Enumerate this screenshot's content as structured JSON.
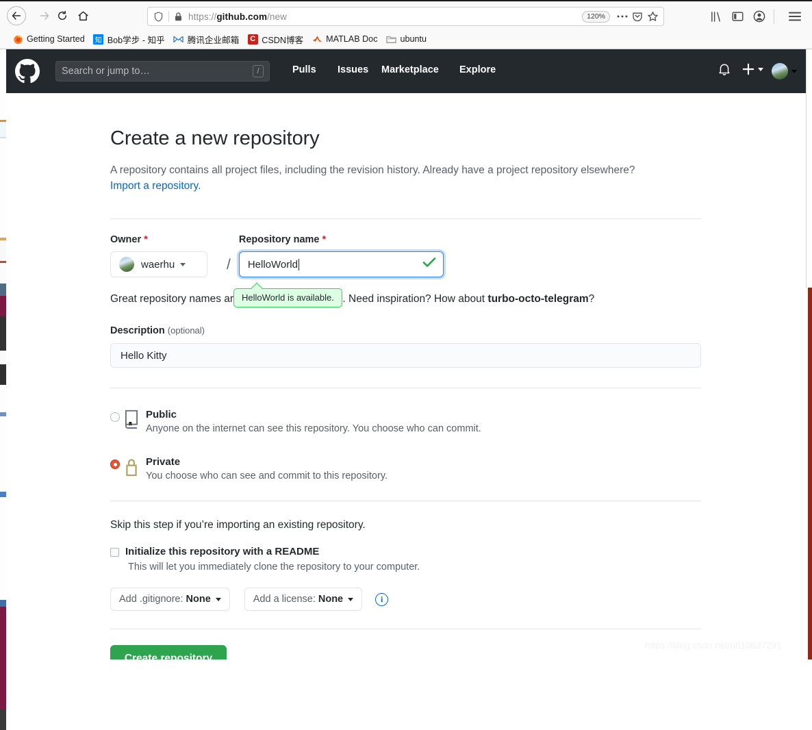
{
  "browser": {
    "nav": {
      "back": "back-arrow",
      "forward": "forward-arrow",
      "reload": "reload-arrow",
      "home": "home-icon"
    },
    "urlbar": {
      "url_prefix": "https://",
      "url_domain": "github.com",
      "url_path": "/new",
      "zoom_level": "120%",
      "shield_icon": "shield-icon",
      "lock_icon": "padlock-icon",
      "more_icon": "ellipsis-icon",
      "pocket_icon": "pocket-icon",
      "bookmark_icon": "star-icon"
    },
    "toolbar_right": {
      "library": "library-icon",
      "sidebar": "sidebar-icon",
      "account": "account-icon",
      "menu": "hamburger-menu-icon"
    },
    "bookmarks": [
      {
        "label": "Getting Started",
        "icon": "firefox-icon"
      },
      {
        "label": "Bob学步 - 知乎",
        "icon": "zhihu-icon"
      },
      {
        "label": "腾讯企业邮箱",
        "icon": "tencent-mail-icon"
      },
      {
        "label": "CSDN博客",
        "icon": "csdn-icon"
      },
      {
        "label": "MATLAB Doc",
        "icon": "matlab-icon"
      },
      {
        "label": "ubuntu",
        "icon": "folder-icon"
      }
    ]
  },
  "github_header": {
    "logo": "github-mark-icon",
    "search_placeholder": "Search or jump to…",
    "search_shortcut": "/",
    "nav": [
      {
        "label": "Pulls"
      },
      {
        "label": "Issues"
      },
      {
        "label": "Marketplace"
      },
      {
        "label": "Explore"
      }
    ],
    "notifications_icon": "bell-icon",
    "create_new_icon": "plus-icon",
    "avatar": "user-avatar"
  },
  "main": {
    "title": "Create a new repository",
    "subtitle": "A repository contains all project files, including the revision history. Already have a project repository elsewhere?",
    "import_link": "Import a repository.",
    "owner": {
      "label": "Owner",
      "required": "*",
      "value": "waerhu",
      "avatar": "owner-avatar"
    },
    "separator": "/",
    "repo_name": {
      "label": "Repository name",
      "required": "*",
      "value": "HelloWorld",
      "valid_icon": "check-icon"
    },
    "availability_tooltip": "HelloWorld is available.",
    "hint": {
      "prefix": "Great repository names are short and memorable. Need inspiration? How about ",
      "suggestion": "turbo-octo-telegram",
      "suffix": "?"
    },
    "description": {
      "label": "Description",
      "optional": "(optional)",
      "value": "Hello Kitty"
    },
    "visibility": [
      {
        "id": "public",
        "title": "Public",
        "desc": "Anyone on the internet can see this repository. You choose who can commit.",
        "icon": "repo-book-icon",
        "selected": false
      },
      {
        "id": "private",
        "title": "Private",
        "desc": "You choose who can see and commit to this repository.",
        "icon": "lock-icon",
        "selected": true
      }
    ],
    "skip_text": "Skip this step if you’re importing an existing repository.",
    "readme": {
      "title": "Initialize this repository with a README",
      "desc": "This will let you immediately clone the repository to your computer.",
      "checked": false
    },
    "gitignore_button": {
      "label": "Add .gitignore:",
      "value": "None"
    },
    "license_button": {
      "label": "Add a license:",
      "value": "None"
    },
    "info_icon": "info-icon",
    "create_button": "Create repository"
  },
  "watermark": "https://blog.csdn.net/u010637291",
  "colors": {
    "github_header_bg": "#24292e",
    "accent_green": "#2ea44f",
    "link_blue": "#0366d6",
    "focus_blue": "#2188ff",
    "required_red": "#cb2431",
    "tooltip_green_bg": "#dcffe4",
    "tooltip_green_border": "#34d058",
    "private_radio": "#e25535",
    "lock_icon_color": "#b3a369"
  }
}
